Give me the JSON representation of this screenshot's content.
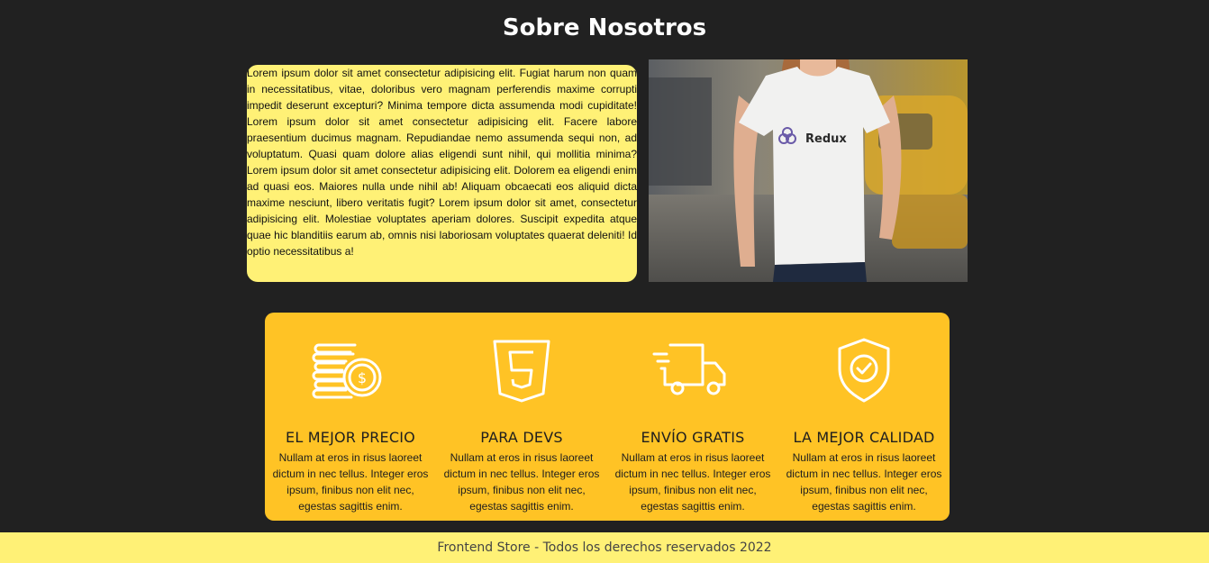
{
  "header": {
    "title": "Sobre Nosotros"
  },
  "about": {
    "text": "Lorem ipsum dolor sit amet consectetur adipisicing elit. Fugiat harum non quam in necessitatibus, vitae, doloribus vero magnam perferendis maxime corrupti impedit deserunt excepturi? Minima tempore dicta assumenda modi cupiditate! Lorem ipsum dolor sit amet consectetur adipisicing elit. Facere labore praesentium ducimus magnam. Repudiandae nemo assumenda sequi non, ad voluptatum. Quasi quam dolore alias eligendi sunt nihil, qui mollitia minima? Lorem ipsum dolor sit amet consectetur adipisicing elit. Dolorem ea eligendi enim ad quasi eos. Maiores nulla unde nihil ab! Aliquam obcaecati eos aliquid dicta maxime nesciunt, libero veritatis fugit? Lorem ipsum dolor sit amet, consectetur adipisicing elit. Molestiae voluptates aperiam dolores. Suscipit expedita atque quae hic blanditiis earum ab, omnis nisi laboriosam voluptates quaerat deleniti! Id optio necessitatibus a!",
    "photo_logo_text": "Redux"
  },
  "features": [
    {
      "icon": "coins-dollar-icon",
      "title": "EL MEJOR PRECIO",
      "text": "Nullam at eros in risus laoreet dictum in nec tellus. Integer eros ipsum, finibus non elit nec, egestas sagittis enim."
    },
    {
      "icon": "html5-icon",
      "title": "PARA DEVS",
      "text": "Nullam at eros in risus laoreet dictum in nec tellus. Integer eros ipsum, finibus non elit nec, egestas sagittis enim."
    },
    {
      "icon": "delivery-truck-icon",
      "title": "ENVÍO GRATIS",
      "text": "Nullam at eros in risus laoreet dictum in nec tellus. Integer eros ipsum, finibus non elit nec, egestas sagittis enim."
    },
    {
      "icon": "shield-check-icon",
      "title": "LA MEJOR CALIDAD",
      "text": "Nullam at eros in risus laoreet dictum in nec tellus. Integer eros ipsum, finibus non elit nec, egestas sagittis enim."
    }
  ],
  "footer": {
    "text": "Frontend Store - Todos los derechos reservados 2022"
  },
  "colors": {
    "background": "#212121",
    "about_card": "#fff176",
    "features_panel": "#ffc325",
    "footer": "#fff176"
  }
}
